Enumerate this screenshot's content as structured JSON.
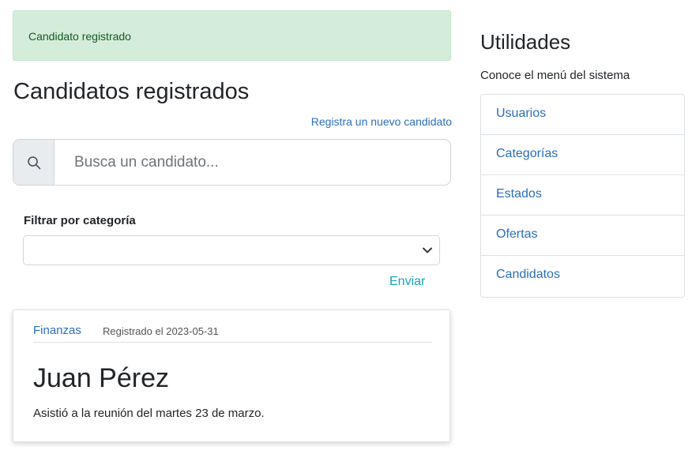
{
  "alert": {
    "message": "Candidato registrado",
    "color": "#d4edda"
  },
  "main": {
    "title": "Candidatos registrados",
    "new_candidate_link": "Registra un nuevo candidato",
    "search": {
      "icon": "search-icon",
      "placeholder": "Busca un candidato...",
      "value": ""
    },
    "filter": {
      "label": "Filtrar por categoría",
      "selected": ""
    },
    "send_label": "Enviar",
    "cards": [
      {
        "category": "Finanzas",
        "registered": "Registrado el 2023-05-31",
        "name": "Juan Pérez",
        "note": "Asistió a la reunión del martes 23 de marzo."
      }
    ]
  },
  "sidebar": {
    "title": "Utilidades",
    "subtitle": "Conoce el menú del sistema",
    "items": [
      {
        "label": "Usuarios"
      },
      {
        "label": "Categorías"
      },
      {
        "label": "Estados"
      },
      {
        "label": "Ofertas"
      },
      {
        "label": "Candidatos"
      }
    ]
  },
  "colors": {
    "link": "#2a6ebb",
    "accent": "#17a2b8"
  }
}
